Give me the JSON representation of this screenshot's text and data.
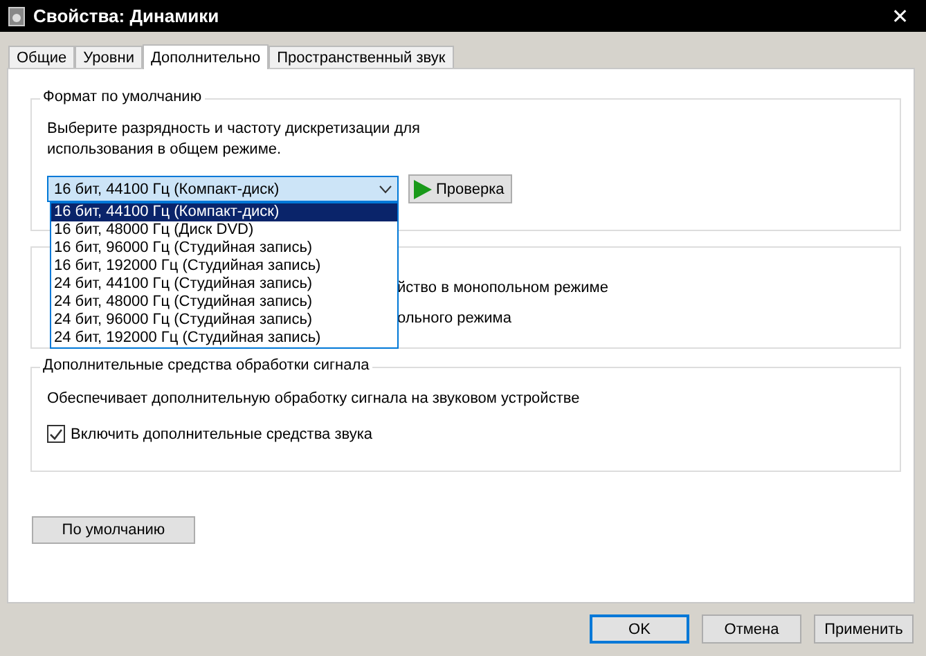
{
  "window": {
    "title": "Свойства: Динамики",
    "close": "✕"
  },
  "tabs": [
    {
      "label": "Общие",
      "selected": false
    },
    {
      "label": "Уровни",
      "selected": false
    },
    {
      "label": "Дополнительно",
      "selected": true
    },
    {
      "label": "Пространственный звук",
      "selected": false
    }
  ],
  "format_group": {
    "title": "Формат по умолчанию",
    "description": "Выберите разрядность и частоту дискретизации для использования в общем режиме.",
    "combo_value": "16 бит, 44100 Гц (Компакт-диск)",
    "test_button": "Проверка",
    "expanded": true,
    "options": [
      {
        "label": "16 бит, 44100 Гц (Компакт-диск)",
        "selected": true
      },
      {
        "label": "16 бит, 48000 Гц (Диск DVD)",
        "selected": false
      },
      {
        "label": "16 бит, 96000 Гц (Студийная запись)",
        "selected": false
      },
      {
        "label": "16 бит, 192000 Гц (Студийная запись)",
        "selected": false
      },
      {
        "label": "24 бит, 44100 Гц (Студийная запись)",
        "selected": false
      },
      {
        "label": "24 бит, 48000 Гц (Студийная запись)",
        "selected": false
      },
      {
        "label": "24 бит, 96000 Гц (Студийная запись)",
        "selected": false
      },
      {
        "label": "24 бит, 192000 Гц (Студийная запись)",
        "selected": false
      }
    ]
  },
  "exclusive_group": {
    "visible_lines": [
      "йство в монопольном режиме",
      "ольного режима"
    ]
  },
  "enhancements_group": {
    "title": "Дополнительные средства обработки сигнала",
    "description": "Обеспечивает дополнительную обработку сигнала на звуковом устройстве",
    "checkbox": {
      "label": "Включить дополнительные средства звука",
      "checked": true
    }
  },
  "default_button": "По умолчанию",
  "buttons": [
    {
      "label": "OK",
      "kind": "default"
    },
    {
      "label": "Отмена",
      "kind": "normal"
    },
    {
      "label": "Применить",
      "kind": "normal"
    }
  ]
}
